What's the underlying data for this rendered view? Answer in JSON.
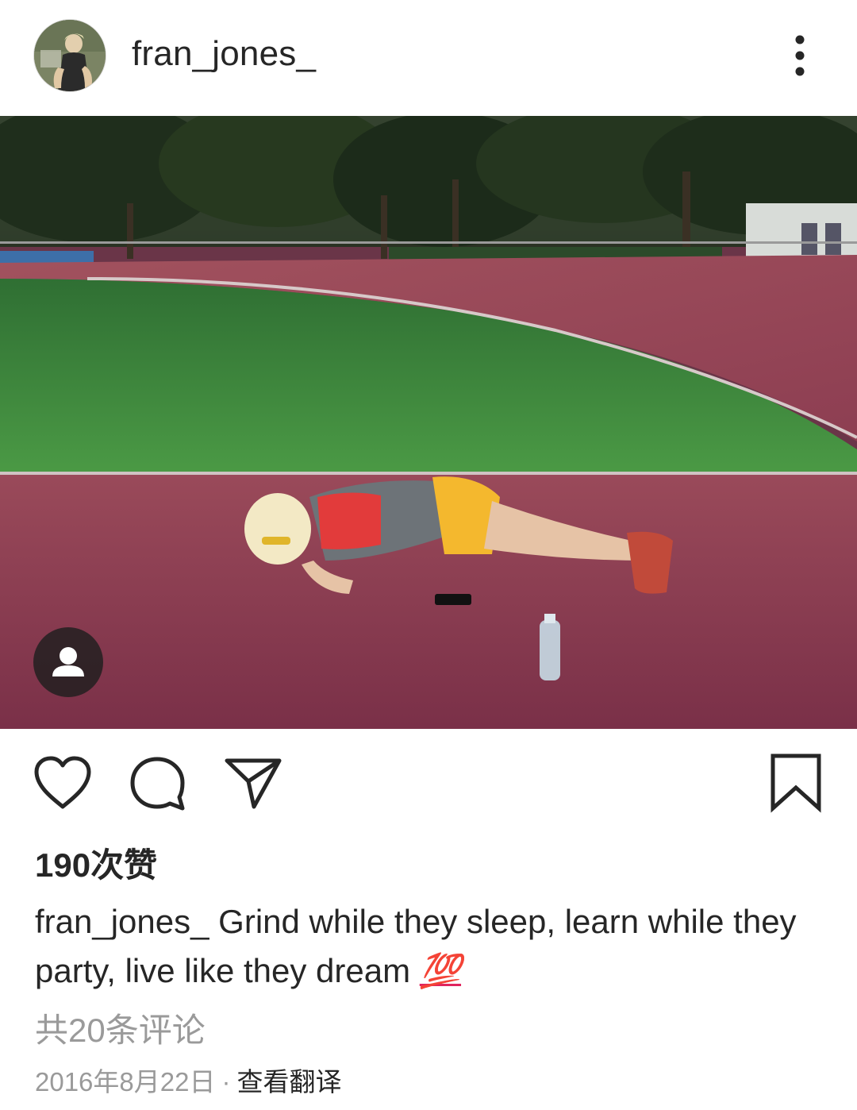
{
  "post": {
    "username": "fran_jones_",
    "likes_text": "190次赞",
    "caption_user": "fran_jones_",
    "caption_text": "Grind while they sleep, learn while they party, live like they dream",
    "caption_emoji": "💯",
    "comments_text": "共20条评论",
    "date": "2016年8月22日",
    "separator": "·",
    "translate_label": "查看翻译"
  },
  "icons": {
    "more": "more-vertical-icon",
    "tag": "person-tag-icon",
    "like": "heart-icon",
    "comment": "comment-bubble-icon",
    "share": "paper-plane-icon",
    "save": "bookmark-icon"
  },
  "colors": {
    "text": "#262626",
    "muted": "#9a9a9a",
    "track": "#8a3a4f",
    "grass": "#3f8a3a"
  }
}
